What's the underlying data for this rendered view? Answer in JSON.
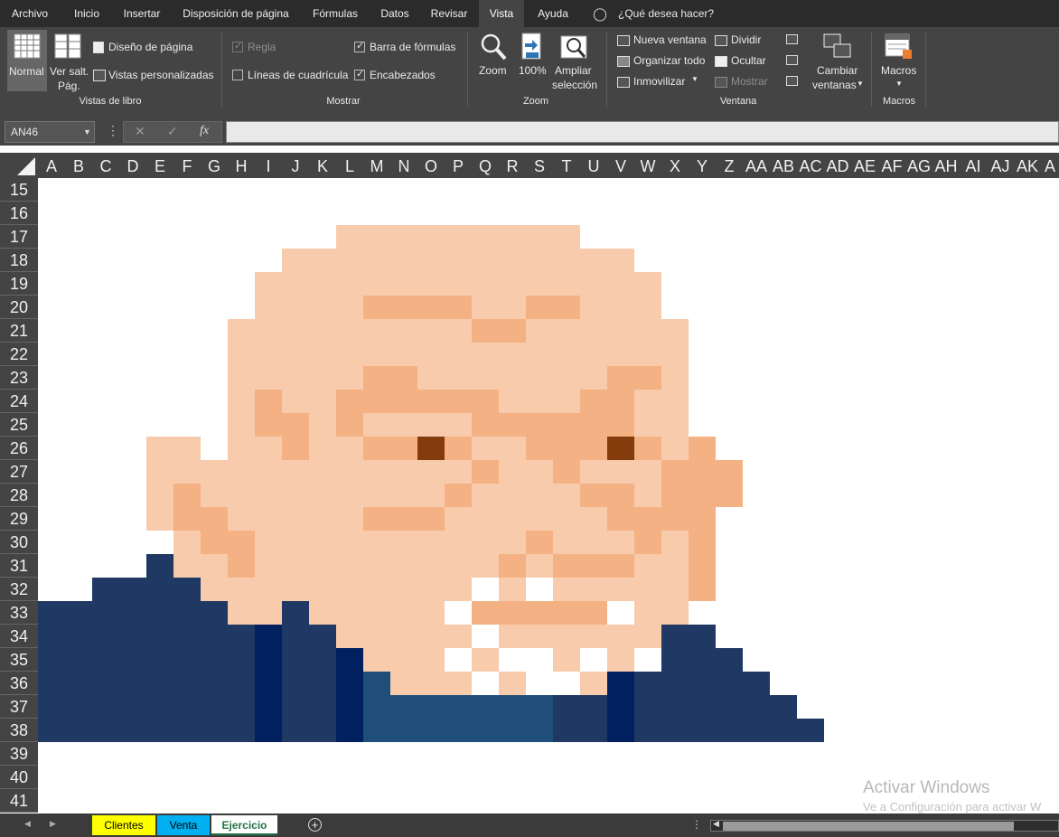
{
  "menu": {
    "tabs": [
      "Archivo",
      "Inicio",
      "Insertar",
      "Disposición de página",
      "Fórmulas",
      "Datos",
      "Revisar",
      "Vista",
      "Ayuda"
    ],
    "active_tab": "Vista",
    "tell_me": "¿Qué desea hacer?"
  },
  "ribbon": {
    "vistas_libro": {
      "label": "Vistas de libro",
      "normal": "Normal",
      "ver_salto_1": "Ver salt.",
      "ver_salto_2": "Pág.",
      "diseno_pagina": "Diseño de página",
      "vistas_personalizadas": "Vistas personalizadas"
    },
    "mostrar": {
      "label": "Mostrar",
      "regla": "Regla",
      "lineas_cuadricula": "Líneas de cuadrícula",
      "barra_formulas": "Barra de fórmulas",
      "encabezados": "Encabezados"
    },
    "zoom": {
      "label": "Zoom",
      "zoom": "Zoom",
      "cien": "100%",
      "ampliar_1": "Ampliar",
      "ampliar_2": "selección"
    },
    "ventana": {
      "label": "Ventana",
      "nueva_ventana": "Nueva ventana",
      "organizar_todo": "Organizar todo",
      "inmovilizar": "Inmovilizar",
      "dividir": "Dividir",
      "ocultar": "Ocultar",
      "mostrar": "Mostrar",
      "cambiar_1": "Cambiar",
      "cambiar_2": "ventanas"
    },
    "macros": {
      "label": "Macros",
      "macros": "Macros"
    }
  },
  "formula_bar": {
    "name_box": "AN46",
    "cancel_icon": "✕",
    "enter_icon": "✓",
    "fx_icon": "fx",
    "value": ""
  },
  "columns": [
    "A",
    "B",
    "C",
    "D",
    "E",
    "F",
    "G",
    "H",
    "I",
    "J",
    "K",
    "L",
    "M",
    "N",
    "O",
    "P",
    "Q",
    "R",
    "S",
    "T",
    "U",
    "V",
    "W",
    "X",
    "Y",
    "Z",
    "AA",
    "AB",
    "AC",
    "AD",
    "AE",
    "AF",
    "AG",
    "AH",
    "AI",
    "AJ",
    "AK",
    "A"
  ],
  "rows": [
    "15",
    "16",
    "17",
    "18",
    "19",
    "20",
    "21",
    "22",
    "23",
    "24",
    "25",
    "26",
    "27",
    "28",
    "29",
    "30",
    "31",
    "32",
    "33",
    "34",
    "35",
    "36",
    "37",
    "38",
    "39",
    "40",
    "41"
  ],
  "pixel_art": {
    "palette": {
      "S": "#F8CBAD",
      "O": "#F4B183",
      "D": "#843C0C",
      "W": "#FFFFFF",
      "N": "#1F3864",
      "K": "#002060",
      "T": "#1F4E79"
    },
    "rows": [
      "................................",
      "................................",
      "...........SSSSSSSSS............",
      ".........SSSSSSSSSSSSS..........",
      "........SSSSSSSSSSSSSSS.........",
      "........SSSSOOOOSSOOSSS.........",
      ".......SSSSSSSSSOOSSSSSS........",
      ".......SSSSSSSSSSSSSSSSS........",
      ".......SSSSSOOSSSSSSSOOS........",
      ".......SOSSOOOOOOSSSOOSS........",
      ".......SOOSOSSSSOOOOOOSS........",
      "....SS.SSOSSOODOSSOOODOSO.......",
      "....SSSSSSSSSSSSOSSOSSSOOO......",
      "....SOSSSSSSSSSOSSSSOOSOOO......",
      "....SOOSSSSSOOOSSSSSSOOOO.......",
      ".....SOOSSSSSSSSSSOSSSOSO.......",
      "....NSSOSSSSSSSSSOSOOOSSO.......",
      "..NNNNSSSSSSSSSSWSWSSSSSO.......",
      "NNNNNNNSSNSSSSSWOOOOOWSS........",
      "NNNNNNNNKNNSSSSSWSSSSSSNN.......",
      "NNNNNNNNKNNKSSSWSWWSWSWNNN......",
      "NNNNNNNNKNNKTSSSWSWWSKNNNNN.....",
      "NNNNNNNNKNNKTTTTTTTNNKNNNNNN....",
      "NNNNNNNNKNNKTTTTTTTNNKNNNNNNN..."
    ]
  },
  "watermark": {
    "line1": "Activar Windows",
    "line2": "Ve a Configuración para activar W"
  },
  "sheets": {
    "tabs": [
      "Clientes",
      "Venta",
      "Ejercicio"
    ],
    "active": "Ejercicio",
    "colors": [
      "#FFFF00",
      "#00B0F0",
      "#FFFFFF"
    ]
  }
}
